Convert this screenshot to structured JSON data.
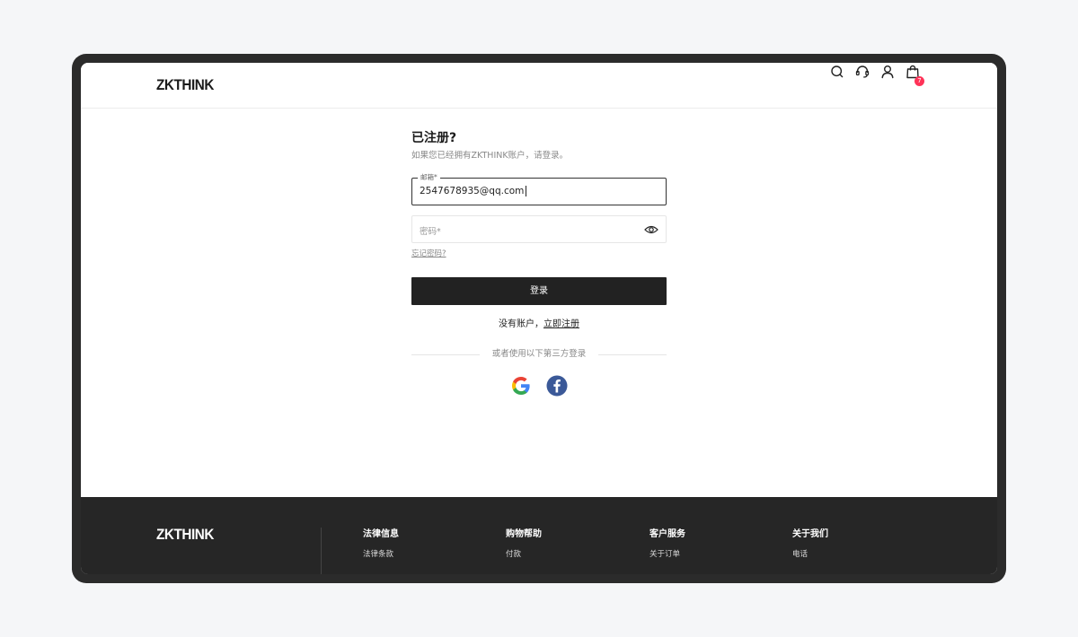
{
  "header": {
    "logo": "ZKTHINK",
    "cart_count": "7",
    "icons": [
      "search-icon",
      "customer-service-icon",
      "user-icon",
      "shopping-bag-icon"
    ]
  },
  "login": {
    "title": "已注册?",
    "subtitle": "如果您已经拥有ZKTHINK账户，请登录。",
    "email_label": "邮箱*",
    "email_value": "2547678935@qq.com",
    "password_placeholder": "密码*",
    "forgot_label": "忘记密码?",
    "login_button": "登录",
    "no_account_text": "没有账户，",
    "register_link": "立即注册",
    "divider_text": "或者使用以下第三方登录"
  },
  "social": [
    "google-icon",
    "facebook-icon"
  ],
  "colors": {
    "button": "#222222",
    "footer": "#262626",
    "badge": "#ff3358",
    "facebook": "#3b5998"
  },
  "footer": {
    "logo": "ZKTHINK",
    "columns": [
      {
        "title": "法律信息",
        "items": [
          "法律条款"
        ]
      },
      {
        "title": "购物帮助",
        "items": [
          "付款"
        ]
      },
      {
        "title": "客户服务",
        "items": [
          "关于订单"
        ]
      },
      {
        "title": "关于我们",
        "items": [
          "电话"
        ]
      }
    ]
  }
}
